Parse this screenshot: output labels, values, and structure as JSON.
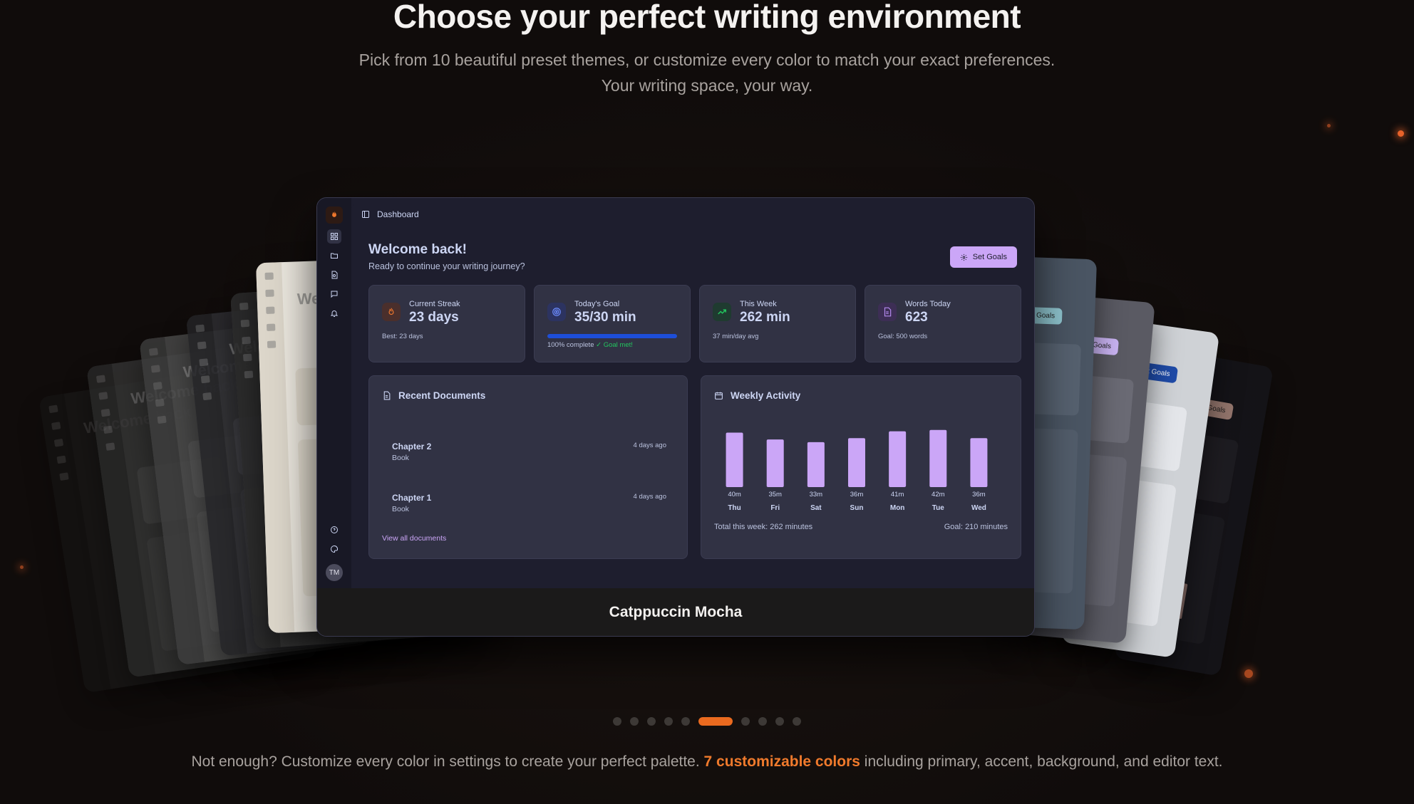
{
  "section": {
    "headline": "Choose your perfect writing environment",
    "subhead": "Pick from 10 beautiful preset themes, or customize every color to match your exact preferences. Your writing space, your way."
  },
  "app": {
    "breadcrumb": "Dashboard",
    "welcome_title": "Welcome back!",
    "welcome_sub": "Ready to continue your writing journey?",
    "set_goals_label": "Set Goals",
    "avatar_initials": "TM",
    "stats": [
      {
        "label": "Current Streak",
        "value": "23 days",
        "foot": "Best: 23 days",
        "icon": "flame-icon"
      },
      {
        "label": "Today's Goal",
        "value": "35/30 min",
        "foot_main": "100% complete",
        "foot_ok": "✓ Goal met!",
        "progress": 1.0,
        "icon": "target-icon"
      },
      {
        "label": "This Week",
        "value": "262 min",
        "foot": "37 min/day avg",
        "icon": "trending-up-icon"
      },
      {
        "label": "Words Today",
        "value": "623",
        "foot": "Goal: 500 words",
        "icon": "document-icon"
      }
    ],
    "recent_documents": {
      "title": "Recent Documents",
      "items": [
        {
          "name": "Chapter 2",
          "type": "Book",
          "when": "4 days ago"
        },
        {
          "name": "Chapter 1",
          "type": "Book",
          "when": "4 days ago"
        }
      ],
      "view_all": "View all documents"
    },
    "weekly_activity": {
      "title": "Weekly Activity",
      "total": "Total this week: 262 minutes",
      "goal": "Goal: 210 minutes"
    }
  },
  "chart_data": {
    "type": "bar",
    "categories": [
      "Thu",
      "Fri",
      "Sat",
      "Sun",
      "Mon",
      "Tue",
      "Wed"
    ],
    "values": [
      40,
      35,
      33,
      36,
      41,
      42,
      36
    ],
    "value_labels": [
      "40m",
      "35m",
      "33m",
      "36m",
      "41m",
      "42m",
      "36m"
    ],
    "ylim": [
      0,
      45
    ],
    "color": "#cba6f7"
  },
  "theme_name": "Catppuccin Mocha",
  "carousel": {
    "count": 10,
    "active_index": 5
  },
  "footer": {
    "before": "Not enough? Customize every color in settings to create your perfect palette.",
    "highlight": "7 customizable colors",
    "after": "including primary, accent, background, and editor text."
  },
  "colors": {
    "accent": "#ea6a1f",
    "mocha_base": "#1e1e2e",
    "mocha_mauve": "#cba6f7"
  }
}
